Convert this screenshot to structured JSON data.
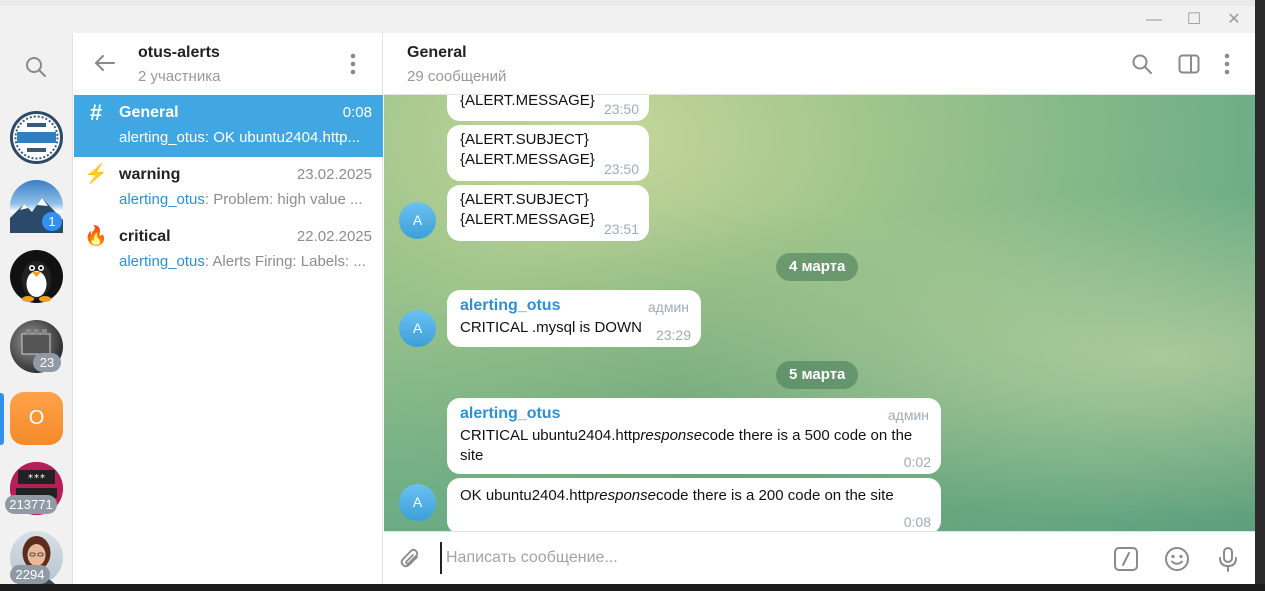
{
  "window": {
    "controls": {
      "minimize": "—",
      "maximize": "☐",
      "close": "✕"
    }
  },
  "folders": {
    "search_icon": "search-icon",
    "items": [
      {
        "name": "303-redirect",
        "badge": ""
      },
      {
        "name": "mountains",
        "badge": "1"
      },
      {
        "name": "linux-penguin",
        "badge": ""
      },
      {
        "name": "engine",
        "badge": "23"
      },
      {
        "name": "otus-alerts",
        "letter": "O",
        "badge": ""
      },
      {
        "name": "umo",
        "badge": "213771"
      },
      {
        "name": "woman",
        "badge": "2294"
      }
    ],
    "accent": "#3390ec"
  },
  "chatlist": {
    "title": "otus-alerts",
    "subtitle": "2 участника",
    "rows": [
      {
        "icon": "#",
        "name": "General",
        "time": "0:08",
        "sender": "",
        "preview": "alerting_otus: OK ubuntu2404.http..."
      },
      {
        "icon": "⚡",
        "name": "warning",
        "time": "23.02.2025",
        "sender": "alerting_otus",
        "preview": ": Problem: high value ..."
      },
      {
        "icon": "🔥",
        "name": "critical",
        "time": "22.02.2025",
        "sender": "alerting_otus",
        "preview": ": Alerts Firing: Labels: ..."
      }
    ]
  },
  "chat": {
    "title": "General",
    "subtitle": "29 сообщений",
    "messages": [
      {
        "lines": [
          "{ALERT.MESSAGE}"
        ],
        "time": "23:50"
      },
      {
        "lines": [
          "{ALERT.SUBJECT}",
          "{ALERT.MESSAGE}"
        ],
        "time": "23:50"
      },
      {
        "lines": [
          "{ALERT.SUBJECT}",
          "{ALERT.MESSAGE}"
        ],
        "time": "23:51",
        "avatar": "A"
      },
      {
        "date": "4 марта"
      },
      {
        "author": "alerting_otus",
        "role": "админ",
        "lines": [
          "CRITICAL .mysql is DOWN"
        ],
        "time": "23:29",
        "avatar": "A"
      },
      {
        "date": "5 марта"
      },
      {
        "author": "alerting_otus",
        "role": "админ",
        "lines": [
          "CRITICAL ubuntu2404.httpresponsecode there is a 500 code on the",
          "site"
        ],
        "time": "0:02"
      },
      {
        "lines": [
          "OK ubuntu2404.httpresponsecode there is a 200 code on the site"
        ],
        "time": "0:08",
        "avatar": "A"
      }
    ],
    "msg7_parts": {
      "a": "CRITICAL ubuntu2404.http",
      "b": "response",
      "c": "code there is a 500 code on the",
      "d": "site"
    },
    "msg8_parts": {
      "a": "OK ubuntu2404.http",
      "b": "response",
      "c": "code there is a 200 code on the site"
    }
  },
  "composer": {
    "placeholder": "Написать сообщение..."
  }
}
